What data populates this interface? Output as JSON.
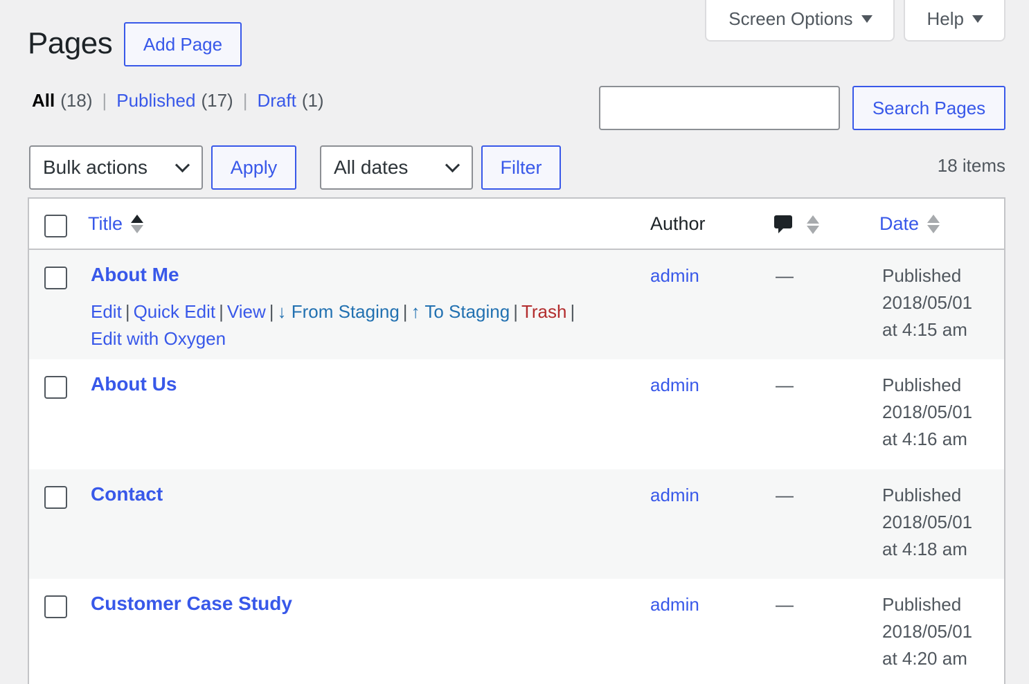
{
  "header": {
    "title": "Pages",
    "add_button": "Add Page",
    "screen_options": "Screen Options",
    "help": "Help"
  },
  "views": {
    "all_label": "All",
    "all_count": "(18)",
    "published_label": "Published",
    "published_count": "(17)",
    "draft_label": "Draft",
    "draft_count": "(1)"
  },
  "search": {
    "value": "",
    "button": "Search Pages"
  },
  "toolbar": {
    "bulk_actions": "Bulk actions",
    "apply": "Apply",
    "dates": "All dates",
    "filter": "Filter",
    "items_count": "18 items"
  },
  "table": {
    "columns": {
      "title": "Title",
      "author": "Author",
      "comments_icon": "comment-bubble-icon",
      "date": "Date"
    },
    "row_actions": {
      "edit": "Edit",
      "quick_edit": "Quick Edit",
      "view": "View",
      "from_staging": "↓ From Staging",
      "to_staging": "↑ To Staging",
      "trash": "Trash",
      "edit_oxygen": "Edit with Oxygen"
    },
    "rows": [
      {
        "title": "About Me",
        "author": "admin",
        "comments": "—",
        "status": "Published",
        "date": "2018/05/01",
        "time": "at 4:15 am"
      },
      {
        "title": "About Us",
        "author": "admin",
        "comments": "—",
        "status": "Published",
        "date": "2018/05/01",
        "time": "at 4:16 am"
      },
      {
        "title": "Contact",
        "author": "admin",
        "comments": "—",
        "status": "Published",
        "date": "2018/05/01",
        "time": "at 4:18 am"
      },
      {
        "title": "Customer Case Study",
        "author": "admin",
        "comments": "—",
        "status": "Published",
        "date": "2018/05/01",
        "time": "at 4:20 am"
      }
    ]
  },
  "colors": {
    "accent": "#3858e9",
    "trash": "#b32d2e",
    "background": "#f0f0f1"
  }
}
